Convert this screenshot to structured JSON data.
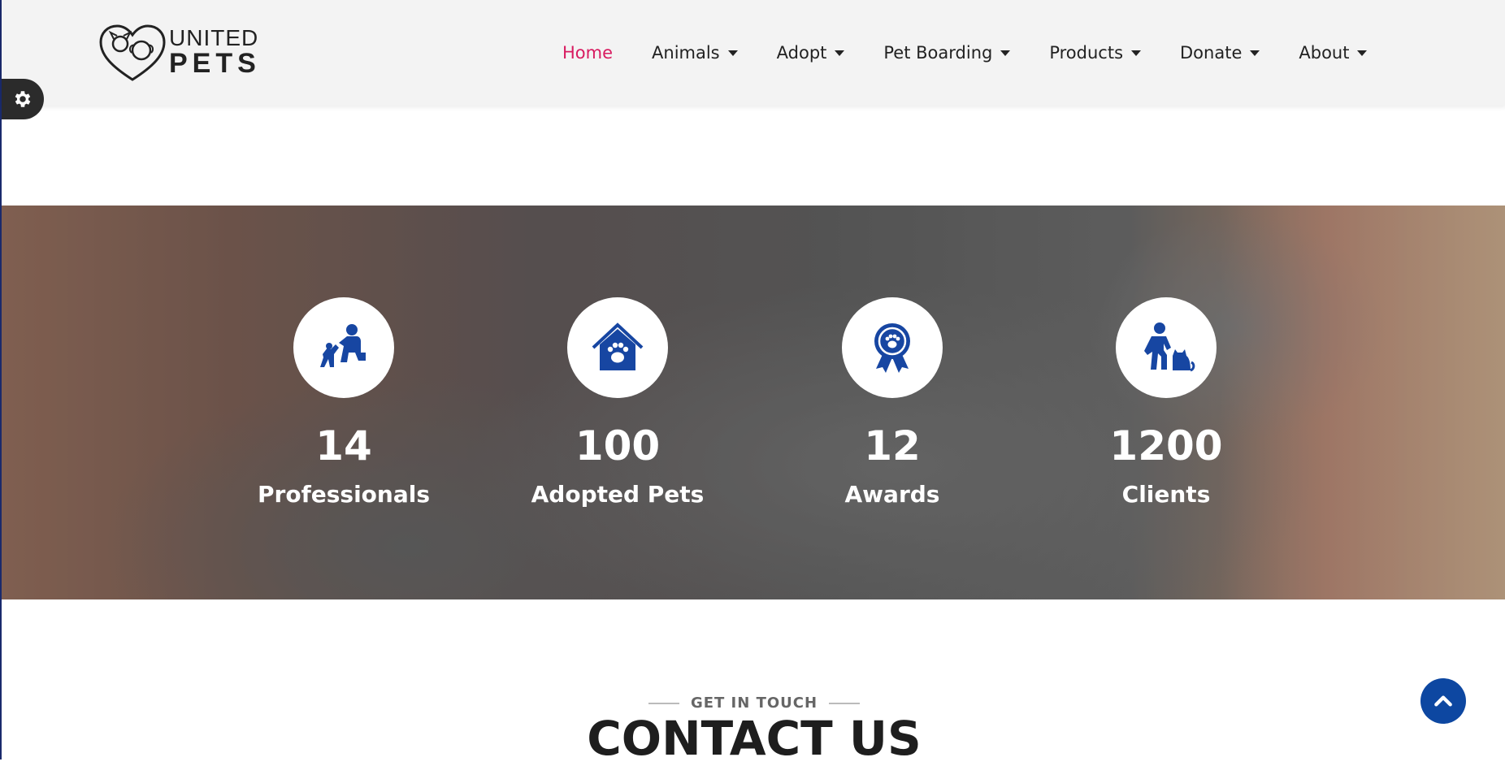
{
  "header": {
    "logo": {
      "line1": "UNITED",
      "line2": "PETS"
    },
    "nav": [
      {
        "label": "Home",
        "active": true,
        "dropdown": false
      },
      {
        "label": "Animals",
        "dropdown": true
      },
      {
        "label": "Adopt",
        "dropdown": true
      },
      {
        "label": "Pet Boarding",
        "dropdown": true
      },
      {
        "label": "Products",
        "dropdown": true
      },
      {
        "label": "Donate",
        "dropdown": true
      },
      {
        "label": "About",
        "dropdown": true
      }
    ]
  },
  "settings": {
    "icon": "gear-icon"
  },
  "stats": [
    {
      "value": "14",
      "label": "Professionals",
      "icon": "trainer-dog-icon"
    },
    {
      "value": "100",
      "label": "Adopted Pets",
      "icon": "pet-house-paw-icon"
    },
    {
      "value": "12",
      "label": "Awards",
      "icon": "award-ribbon-icon"
    },
    {
      "value": "1200",
      "label": "Clients",
      "icon": "person-cat-icon"
    }
  ],
  "contact": {
    "eyebrow": "GET IN TOUCH",
    "title": "CONTACT US"
  },
  "colors": {
    "accent": "#d81b60",
    "primary": "#0d47a1",
    "icon_blue": "#1746a2"
  }
}
